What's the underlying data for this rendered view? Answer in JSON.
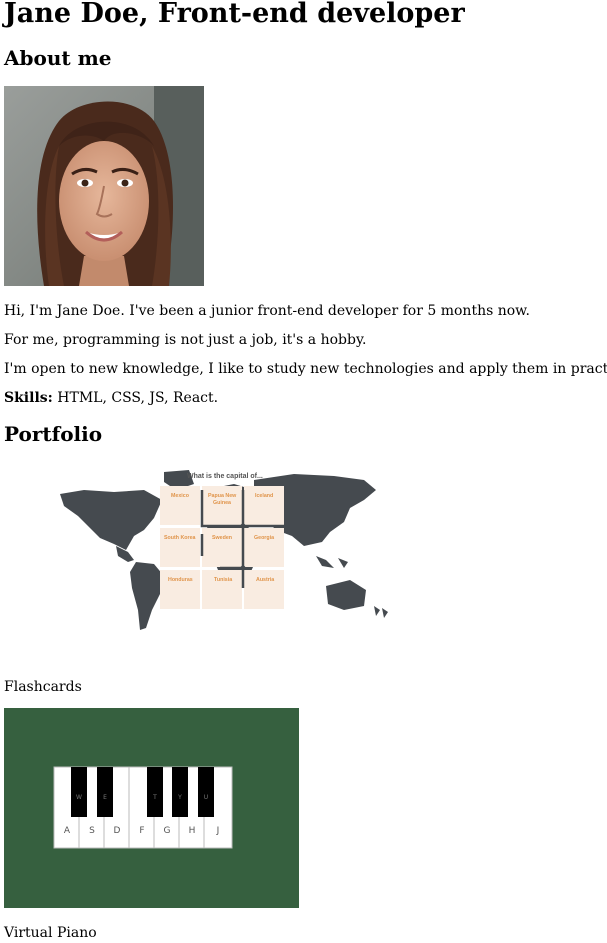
{
  "header": {
    "title": "Jane Doe, Front-end developer"
  },
  "about": {
    "heading": "About me",
    "photo_alt": "Jane Doe",
    "paragraphs": [
      "Hi, I'm Jane Doe. I've been a junior front-end developer for 5 months now.",
      "For me, programming is not just a job, it's a hobby.",
      "I'm open to new knowledge, I like to study new technologies and apply them in practice."
    ],
    "skills_label": "Skills:",
    "skills_value": " HTML, CSS, JS, React."
  },
  "portfolio": {
    "heading": "Portfolio",
    "projects": [
      {
        "caption": "Flashcards",
        "thumbnail_question": "What is the capital of...",
        "cards": [
          "Mexico",
          "Papua New",
          "Guinea",
          "Iceland",
          "South Korea",
          "Sweden",
          "Georgia",
          "Honduras",
          "Tunisia",
          "Austria"
        ]
      },
      {
        "caption": "Virtual Piano",
        "white_keys": [
          "A",
          "S",
          "D",
          "F",
          "G",
          "H",
          "J"
        ],
        "black_keys": [
          "W",
          "E",
          "T",
          "Y",
          "U"
        ]
      }
    ]
  },
  "colors": {
    "piano_background": "#36603f",
    "card_fill": "#f9ece1",
    "card_text": "#e0944a",
    "map_fill": "#454a4f"
  }
}
